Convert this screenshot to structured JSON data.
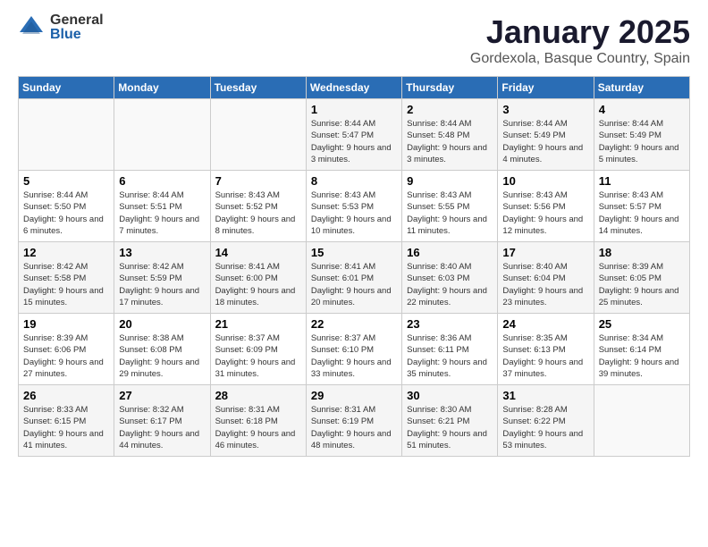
{
  "logo": {
    "general": "General",
    "blue": "Blue"
  },
  "title": {
    "month": "January 2025",
    "location": "Gordexola, Basque Country, Spain"
  },
  "weekdays": [
    "Sunday",
    "Monday",
    "Tuesday",
    "Wednesday",
    "Thursday",
    "Friday",
    "Saturday"
  ],
  "weeks": [
    [
      {
        "day": "",
        "info": ""
      },
      {
        "day": "",
        "info": ""
      },
      {
        "day": "",
        "info": ""
      },
      {
        "day": "1",
        "info": "Sunrise: 8:44 AM\nSunset: 5:47 PM\nDaylight: 9 hours and 3 minutes."
      },
      {
        "day": "2",
        "info": "Sunrise: 8:44 AM\nSunset: 5:48 PM\nDaylight: 9 hours and 3 minutes."
      },
      {
        "day": "3",
        "info": "Sunrise: 8:44 AM\nSunset: 5:49 PM\nDaylight: 9 hours and 4 minutes."
      },
      {
        "day": "4",
        "info": "Sunrise: 8:44 AM\nSunset: 5:49 PM\nDaylight: 9 hours and 5 minutes."
      }
    ],
    [
      {
        "day": "5",
        "info": "Sunrise: 8:44 AM\nSunset: 5:50 PM\nDaylight: 9 hours and 6 minutes."
      },
      {
        "day": "6",
        "info": "Sunrise: 8:44 AM\nSunset: 5:51 PM\nDaylight: 9 hours and 7 minutes."
      },
      {
        "day": "7",
        "info": "Sunrise: 8:43 AM\nSunset: 5:52 PM\nDaylight: 9 hours and 8 minutes."
      },
      {
        "day": "8",
        "info": "Sunrise: 8:43 AM\nSunset: 5:53 PM\nDaylight: 9 hours and 10 minutes."
      },
      {
        "day": "9",
        "info": "Sunrise: 8:43 AM\nSunset: 5:55 PM\nDaylight: 9 hours and 11 minutes."
      },
      {
        "day": "10",
        "info": "Sunrise: 8:43 AM\nSunset: 5:56 PM\nDaylight: 9 hours and 12 minutes."
      },
      {
        "day": "11",
        "info": "Sunrise: 8:43 AM\nSunset: 5:57 PM\nDaylight: 9 hours and 14 minutes."
      }
    ],
    [
      {
        "day": "12",
        "info": "Sunrise: 8:42 AM\nSunset: 5:58 PM\nDaylight: 9 hours and 15 minutes."
      },
      {
        "day": "13",
        "info": "Sunrise: 8:42 AM\nSunset: 5:59 PM\nDaylight: 9 hours and 17 minutes."
      },
      {
        "day": "14",
        "info": "Sunrise: 8:41 AM\nSunset: 6:00 PM\nDaylight: 9 hours and 18 minutes."
      },
      {
        "day": "15",
        "info": "Sunrise: 8:41 AM\nSunset: 6:01 PM\nDaylight: 9 hours and 20 minutes."
      },
      {
        "day": "16",
        "info": "Sunrise: 8:40 AM\nSunset: 6:03 PM\nDaylight: 9 hours and 22 minutes."
      },
      {
        "day": "17",
        "info": "Sunrise: 8:40 AM\nSunset: 6:04 PM\nDaylight: 9 hours and 23 minutes."
      },
      {
        "day": "18",
        "info": "Sunrise: 8:39 AM\nSunset: 6:05 PM\nDaylight: 9 hours and 25 minutes."
      }
    ],
    [
      {
        "day": "19",
        "info": "Sunrise: 8:39 AM\nSunset: 6:06 PM\nDaylight: 9 hours and 27 minutes."
      },
      {
        "day": "20",
        "info": "Sunrise: 8:38 AM\nSunset: 6:08 PM\nDaylight: 9 hours and 29 minutes."
      },
      {
        "day": "21",
        "info": "Sunrise: 8:37 AM\nSunset: 6:09 PM\nDaylight: 9 hours and 31 minutes."
      },
      {
        "day": "22",
        "info": "Sunrise: 8:37 AM\nSunset: 6:10 PM\nDaylight: 9 hours and 33 minutes."
      },
      {
        "day": "23",
        "info": "Sunrise: 8:36 AM\nSunset: 6:11 PM\nDaylight: 9 hours and 35 minutes."
      },
      {
        "day": "24",
        "info": "Sunrise: 8:35 AM\nSunset: 6:13 PM\nDaylight: 9 hours and 37 minutes."
      },
      {
        "day": "25",
        "info": "Sunrise: 8:34 AM\nSunset: 6:14 PM\nDaylight: 9 hours and 39 minutes."
      }
    ],
    [
      {
        "day": "26",
        "info": "Sunrise: 8:33 AM\nSunset: 6:15 PM\nDaylight: 9 hours and 41 minutes."
      },
      {
        "day": "27",
        "info": "Sunrise: 8:32 AM\nSunset: 6:17 PM\nDaylight: 9 hours and 44 minutes."
      },
      {
        "day": "28",
        "info": "Sunrise: 8:31 AM\nSunset: 6:18 PM\nDaylight: 9 hours and 46 minutes."
      },
      {
        "day": "29",
        "info": "Sunrise: 8:31 AM\nSunset: 6:19 PM\nDaylight: 9 hours and 48 minutes."
      },
      {
        "day": "30",
        "info": "Sunrise: 8:30 AM\nSunset: 6:21 PM\nDaylight: 9 hours and 51 minutes."
      },
      {
        "day": "31",
        "info": "Sunrise: 8:28 AM\nSunset: 6:22 PM\nDaylight: 9 hours and 53 minutes."
      },
      {
        "day": "",
        "info": ""
      }
    ]
  ]
}
